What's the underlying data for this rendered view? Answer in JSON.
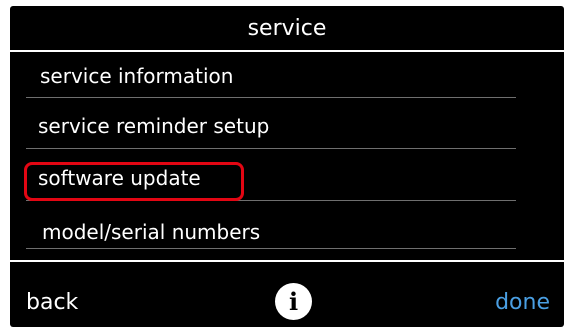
{
  "header": {
    "title": "service"
  },
  "menu": {
    "items": [
      {
        "label": "service information"
      },
      {
        "label": "service reminder setup"
      },
      {
        "label": "software update",
        "highlighted": true
      },
      {
        "label": "model/serial numbers"
      }
    ]
  },
  "footer": {
    "back_label": "back",
    "info_label": "i",
    "done_label": "done"
  },
  "colors": {
    "background": "#000000",
    "text": "#ffffff",
    "done_accent": "#4a9fe3",
    "highlight_outline": "#e30613"
  }
}
